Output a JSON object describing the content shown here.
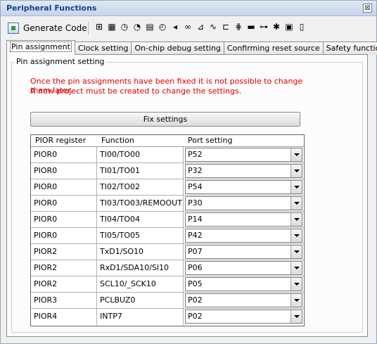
{
  "window": {
    "title": "Peripheral Functions",
    "close_glyph": "⊠"
  },
  "toolbar": {
    "generate_label": "Generate Code",
    "icons": [
      "hierarchy-icon",
      "chip-icon",
      "clock-icon",
      "watchdog-icon",
      "grid-icon",
      "timer-icon",
      "speaker-icon",
      "link-icon",
      "dac-icon",
      "wave-icon",
      "connector-icon",
      "pins-icon",
      "bar-icon",
      "network-icon",
      "star-icon",
      "chip2-icon",
      "battery-icon"
    ]
  },
  "tabs": [
    {
      "label": "Pin assignment",
      "active": true
    },
    {
      "label": "Clock setting",
      "active": false
    },
    {
      "label": "On-chip debug setting",
      "active": false
    },
    {
      "label": "Confirming reset source",
      "active": false
    },
    {
      "label": "Safety functions",
      "active": false
    }
  ],
  "group": {
    "title": "Pin assignment setting",
    "warning_line1": "Once the pin assignments have been fixed it is not possible to change them later.",
    "warning_line2": "A new project must be created to change the settings.",
    "fix_button": "Fix settings"
  },
  "table": {
    "headers": [
      "PIOR register",
      "Function",
      "Port setting"
    ],
    "rows": [
      {
        "register": "PIOR0",
        "function": "TI00/TO00",
        "port": "P52"
      },
      {
        "register": "PIOR0",
        "function": "TI01/TO01",
        "port": "P32"
      },
      {
        "register": "PIOR0",
        "function": "TI02/TO02",
        "port": "P54"
      },
      {
        "register": "PIOR0",
        "function": "TI03/TO03/REMOOUT",
        "port": "P30"
      },
      {
        "register": "PIOR0",
        "function": "TI04/TO04",
        "port": "P14"
      },
      {
        "register": "PIOR0",
        "function": "TI05/TO05",
        "port": "P42"
      },
      {
        "register": "PIOR2",
        "function": "TxD1/SO10",
        "port": "P07"
      },
      {
        "register": "PIOR2",
        "function": "RxD1/SDA10/SI10",
        "port": "P06"
      },
      {
        "register": "PIOR2",
        "function": "SCL10/_SCK10",
        "port": "P05"
      },
      {
        "register": "PIOR3",
        "function": "PCLBUZ0",
        "port": "P02"
      },
      {
        "register": "PIOR4",
        "function": "INTP7",
        "port": "P02"
      }
    ]
  }
}
